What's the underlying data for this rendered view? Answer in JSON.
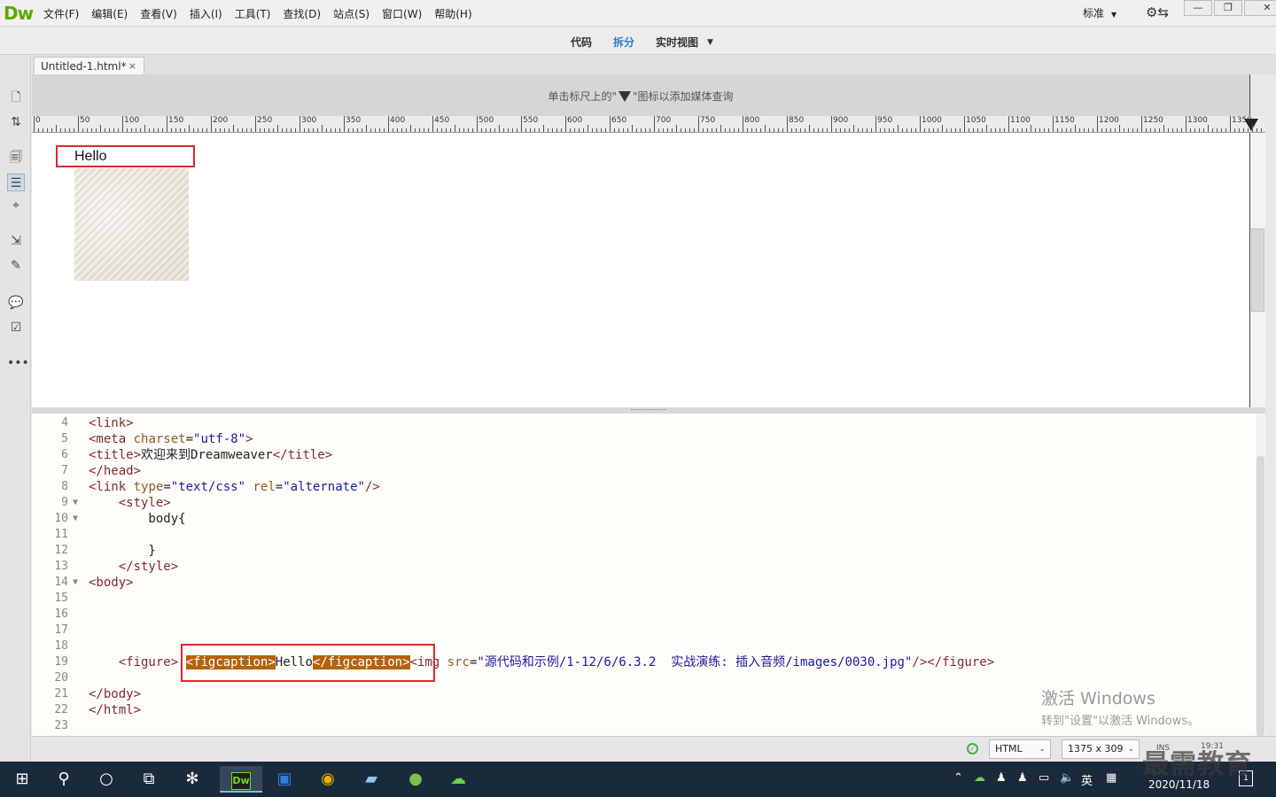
{
  "app": {
    "logo": "Dw",
    "menu": [
      "文件(F)",
      "编辑(E)",
      "查看(V)",
      "插入(I)",
      "工具(T)",
      "查找(D)",
      "站点(S)",
      "窗口(W)",
      "帮助(H)"
    ],
    "workspace": "标准",
    "window_buttons": [
      "—",
      "❐",
      "✕"
    ]
  },
  "view_modes": {
    "code": "代码",
    "split": "拆分",
    "live": "实时视图",
    "active": "拆分"
  },
  "document": {
    "tab_title": "Untitled-1.html*",
    "tab_close": "×"
  },
  "media_query_hint": {
    "before": "单击标尺上的\"",
    "after": "\"图标以添加媒体查询"
  },
  "ruler": {
    "labels": [
      "0",
      "50",
      "100",
      "150",
      "200",
      "250",
      "300",
      "350",
      "400",
      "450",
      "500",
      "550",
      "600",
      "650",
      "700",
      "750",
      "800",
      "850",
      "900",
      "950",
      "1000",
      "1050",
      "1100",
      "1150",
      "1200",
      "1250",
      "1300",
      "1350"
    ]
  },
  "design_view": {
    "caption": "Hello",
    "image_description": "paper texture image"
  },
  "code_view": {
    "lines": [
      {
        "n": "4",
        "fold": "",
        "html": "<link>"
      },
      {
        "n": "5",
        "fold": "",
        "html": "<meta charset=\"utf-8\">"
      },
      {
        "n": "6",
        "fold": "",
        "html": "<title>欢迎来到Dreamweaver</title>"
      },
      {
        "n": "7",
        "fold": "",
        "html": "</head>"
      },
      {
        "n": "8",
        "fold": "",
        "html": "<link type=\"text/css\" rel=\"alternate\"/>"
      },
      {
        "n": "9",
        "fold": "▼",
        "html": "    <style>"
      },
      {
        "n": "10",
        "fold": "▼",
        "html": "        body{"
      },
      {
        "n": "11",
        "fold": "",
        "html": ""
      },
      {
        "n": "12",
        "fold": "",
        "html": "        }"
      },
      {
        "n": "13",
        "fold": "",
        "html": "    </style>"
      },
      {
        "n": "14",
        "fold": "▼",
        "html": "<body>"
      },
      {
        "n": "15",
        "fold": "",
        "html": ""
      },
      {
        "n": "16",
        "fold": "",
        "html": ""
      },
      {
        "n": "17",
        "fold": "",
        "html": ""
      },
      {
        "n": "18",
        "fold": "",
        "html": ""
      },
      {
        "n": "19",
        "fold": "",
        "html": "    <figure> <figcaption>Hello</figcaption><img src=\"源代码和示例/1-12/6/6.3.2  实战演练: 插入音频/images/0030.jpg\"/></figure>"
      },
      {
        "n": "20",
        "fold": "",
        "html": ""
      },
      {
        "n": "21",
        "fold": "",
        "html": "</body>"
      },
      {
        "n": "22",
        "fold": "",
        "html": "</html>"
      },
      {
        "n": "23",
        "fold": "",
        "html": ""
      }
    ]
  },
  "status_bar": {
    "doc_type": "HTML",
    "window_size": "1375 x 309",
    "ins": "INS",
    "cursor_pos": "19:31"
  },
  "watermark": {
    "line1": "激活 Windows",
    "line2": "转到\"设置\"以激活 Windows。"
  },
  "taskbar": {
    "date": "2020/11/18",
    "ime": "英",
    "brand": "最需教育"
  }
}
